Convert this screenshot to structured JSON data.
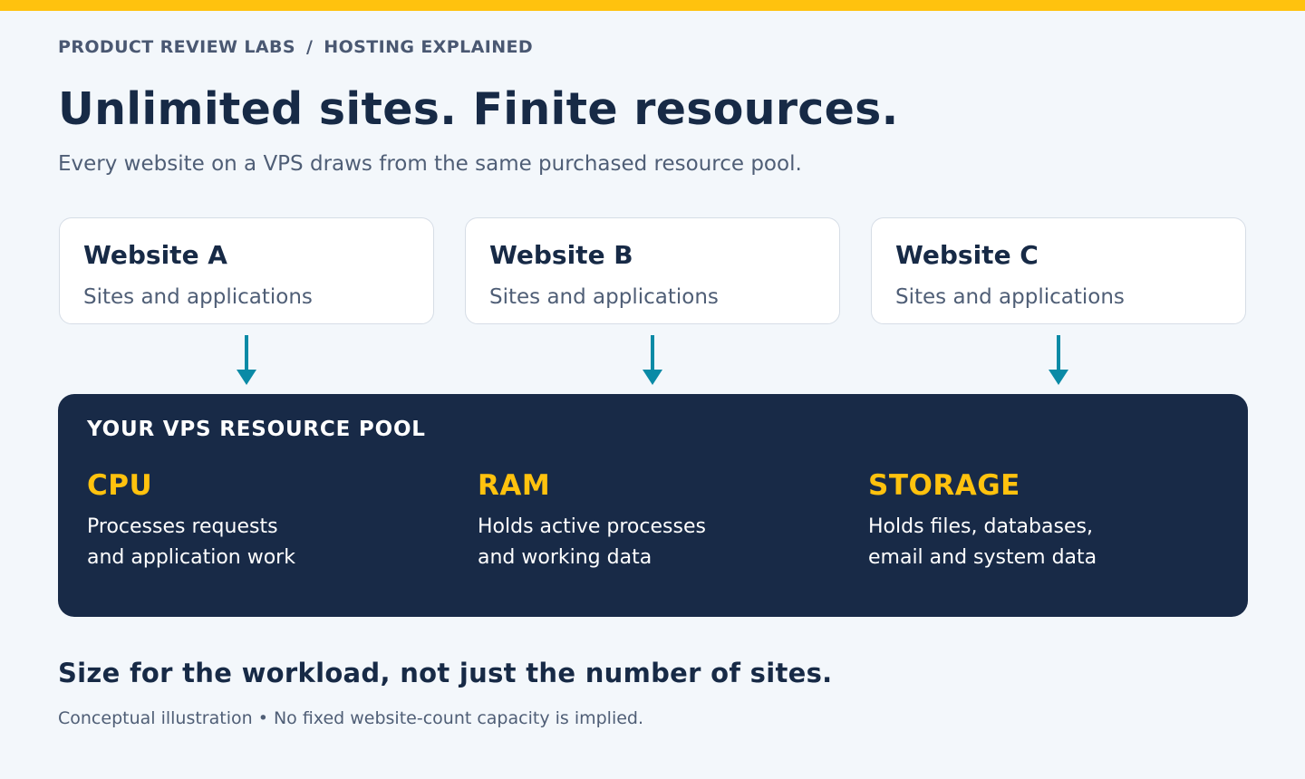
{
  "header": {
    "breadcrumb": [
      "PRODUCT REVIEW LABS",
      "HOSTING EXPLAINED"
    ],
    "breadcrumb_separator": "/",
    "title": "Unlimited sites. Finite resources.",
    "subtitle": "Every website on a VPS draws from the same purchased resource pool."
  },
  "websites": [
    {
      "name": "Website A",
      "description": "Sites and applications"
    },
    {
      "name": "Website B",
      "description": "Sites and applications"
    },
    {
      "name": "Website C",
      "description": "Sites and applications"
    }
  ],
  "pool": {
    "title": "YOUR VPS RESOURCE POOL",
    "resources": [
      {
        "name": "CPU",
        "description_lines": [
          "Processes requests",
          "and application work"
        ]
      },
      {
        "name": "RAM",
        "description_lines": [
          "Holds active processes",
          "and working data"
        ]
      },
      {
        "name": "STORAGE",
        "description_lines": [
          "Holds files, databases,",
          "email and system data"
        ]
      }
    ]
  },
  "footer": {
    "takeaway": "Size for the workload, not just the number of sites.",
    "footnote": "Conceptual illustration • No fixed website-count capacity is implied."
  },
  "colors": {
    "accent": "#ffc20e",
    "navy": "#182a47",
    "arrow": "#0a8aa6",
    "background": "#f3f7fb"
  }
}
